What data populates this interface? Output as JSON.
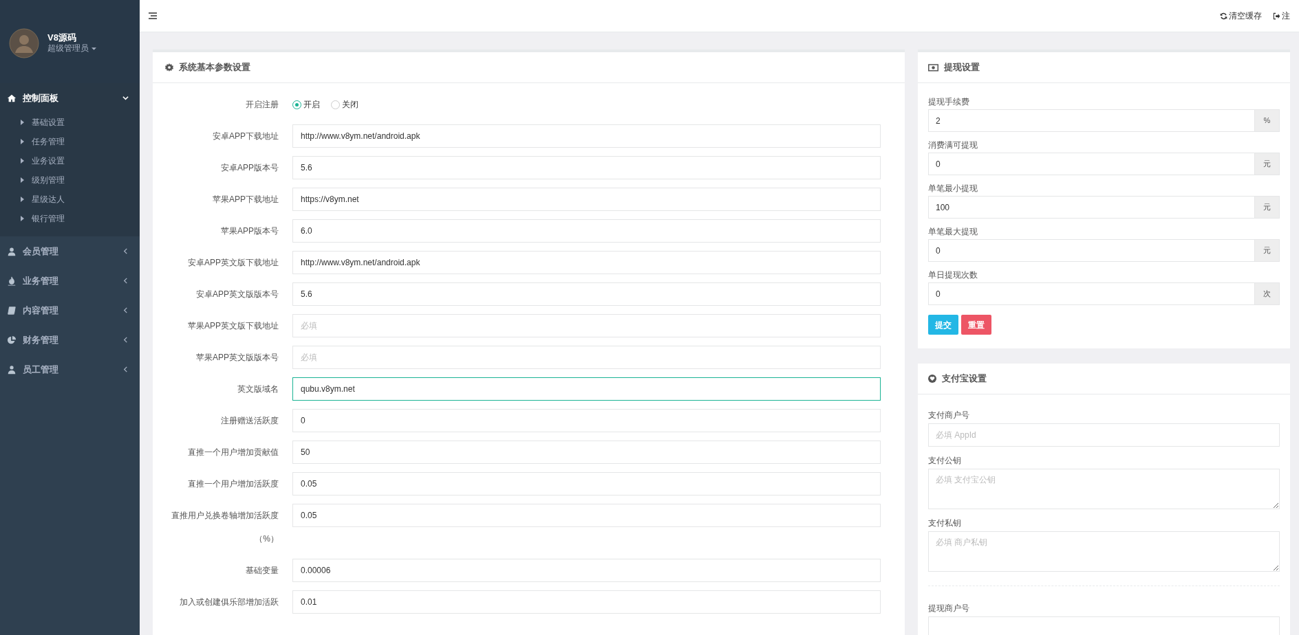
{
  "sidebar": {
    "user": {
      "name": "V8源码",
      "role": "超级管理员"
    },
    "menu": [
      {
        "label": "控制面板",
        "expanded": true,
        "children": [
          {
            "label": "基础设置"
          },
          {
            "label": "任务管理"
          },
          {
            "label": "业务设置"
          },
          {
            "label": "级别管理"
          },
          {
            "label": "星级达人"
          },
          {
            "label": "银行管理"
          }
        ]
      },
      {
        "label": "会员管理",
        "expanded": false
      },
      {
        "label": "业务管理",
        "expanded": false
      },
      {
        "label": "内容管理",
        "expanded": false
      },
      {
        "label": "财务管理",
        "expanded": false
      },
      {
        "label": "员工管理",
        "expanded": false
      }
    ]
  },
  "topbar": {
    "actions": [
      {
        "label": "清空缓存"
      },
      {
        "label": "注"
      }
    ]
  },
  "system_card": {
    "title": "系统基本参数设置",
    "rows": [
      {
        "label": "开启注册",
        "kind": "radio",
        "options": [
          {
            "label": "开启",
            "selected": true
          },
          {
            "label": "关闭",
            "selected": false
          }
        ]
      },
      {
        "label": "安卓APP下载地址",
        "kind": "input",
        "value": "http://www.v8ym.net/android.apk",
        "focused": false
      },
      {
        "label": "安卓APP版本号",
        "kind": "input",
        "value": "5.6",
        "focused": false
      },
      {
        "label": "苹果APP下载地址",
        "kind": "input",
        "value": "https://v8ym.net",
        "focused": false
      },
      {
        "label": "苹果APP版本号",
        "kind": "input",
        "value": "6.0",
        "focused": false
      },
      {
        "label": "安卓APP英文版下载地址",
        "kind": "input",
        "value": "http://www.v8ym.net/android.apk",
        "focused": false
      },
      {
        "label": "安卓APP英文版版本号",
        "kind": "input",
        "value": "5.6",
        "focused": false
      },
      {
        "label": "苹果APP英文版下载地址",
        "kind": "input",
        "placeholder": "必填",
        "focused": false
      },
      {
        "label": "苹果APP英文版版本号",
        "kind": "input",
        "placeholder": "必填",
        "focused": false
      },
      {
        "label": "英文版域名",
        "kind": "input",
        "value": "qubu.v8ym.net",
        "focused": true
      },
      {
        "label": "注册赠送活跃度",
        "kind": "input",
        "value": "0",
        "focused": false
      },
      {
        "label": "直推一个用户增加贡献值",
        "kind": "input",
        "value": "50",
        "focused": false
      },
      {
        "label": "直推一个用户增加活跃度",
        "kind": "input",
        "value": "0.05",
        "focused": false
      },
      {
        "label": "直推用户兑换卷轴增加活跃度（%）",
        "kind": "input",
        "value": "0.05",
        "focused": false
      },
      {
        "label": "基础变量",
        "kind": "input",
        "value": "0.00006",
        "focused": false
      },
      {
        "label": "加入或创建俱乐部增加活跃",
        "kind": "input",
        "value": "0.01",
        "focused": false
      }
    ]
  },
  "withdraw_card": {
    "title": "提现设置",
    "fields": [
      {
        "label": "提现手续费",
        "value": "2",
        "addon": "%"
      },
      {
        "label": "消费满可提现",
        "value": "0",
        "addon": "元"
      },
      {
        "label": "单笔最小提现",
        "value": "100",
        "addon": "元"
      },
      {
        "label": "单笔最大提现",
        "value": "0",
        "addon": "元"
      },
      {
        "label": "单日提现次数",
        "value": "0",
        "addon": "次"
      }
    ],
    "buttons": [
      {
        "label": "提交",
        "kind": "primary"
      },
      {
        "label": "重置",
        "kind": "danger"
      }
    ]
  },
  "alipay_card": {
    "title": "支付宝设置",
    "fields": [
      {
        "label": "支付商户号",
        "kind": "input",
        "placeholder": "必填 AppId"
      },
      {
        "label": "支付公钥",
        "kind": "textarea",
        "placeholder": "必填 支付宝公钥"
      },
      {
        "label": "支付私钥",
        "kind": "textarea",
        "placeholder": "必填 商户私钥"
      },
      {
        "label": "提现商户号",
        "kind": "input",
        "divider": true
      }
    ]
  }
}
